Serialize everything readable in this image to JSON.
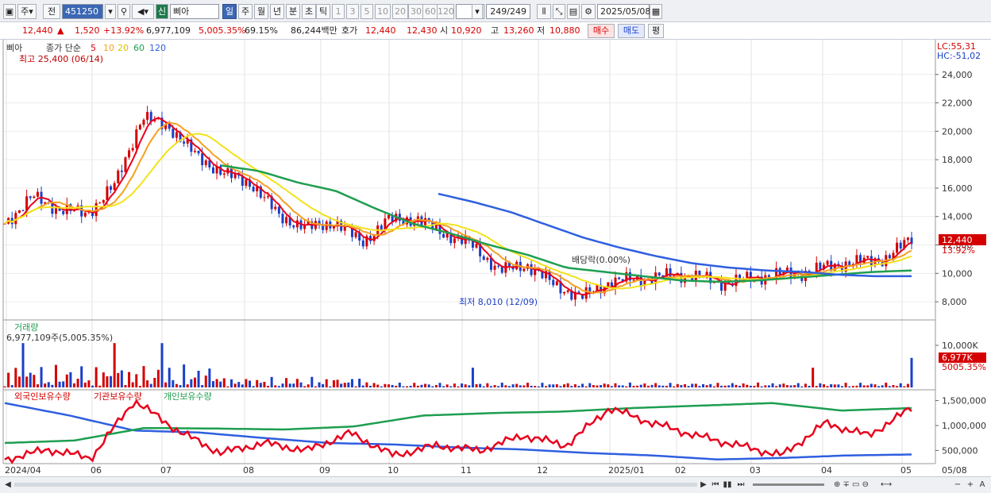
{
  "toolbar": {
    "market": "주",
    "prefix": "전",
    "code": "451250",
    "badge": "신",
    "name": "삐아",
    "periods": [
      "일",
      "주",
      "월",
      "년",
      "분",
      "초",
      "틱"
    ],
    "active_period": "일",
    "intervals": [
      "1",
      "3",
      "5",
      "10",
      "20",
      "30",
      "60",
      "120"
    ],
    "count": "249/249",
    "date": "2025/05/08"
  },
  "quote": {
    "price": "12,440",
    "arrow": "▲",
    "change": "1,520",
    "rate": "+13.92%",
    "volume": "6,977,109",
    "vol_rate": "5,005.35%",
    "turnover": "69.15%",
    "amount": "86,244백만",
    "hoga_label": "호가",
    "ask": "12,440",
    "bid": "12,430",
    "open_label": "시",
    "open": "10,920",
    "high_label": "고",
    "high": "13,260",
    "low_label": "저",
    "low": "10,880",
    "buy_btn": "매수",
    "sell_btn": "매도",
    "eval_btn": "평"
  },
  "legend": {
    "stock": "삐아",
    "ma_label": "종가 단순",
    "ma": [
      {
        "period": "5",
        "color": "#e8001c"
      },
      {
        "period": "10",
        "color": "#f5a020"
      },
      {
        "period": "20",
        "color": "#f2e21a"
      },
      {
        "period": "60",
        "color": "#1e9e50"
      },
      {
        "period": "120",
        "color": "#2f5fe0"
      }
    ],
    "lc": "LC:55,31",
    "hc": "HC:-51,02"
  },
  "annotations": {
    "high": "최고 25,400 (06/14)",
    "low": "최저 8,010 (12/09)",
    "dividend": "배당락(0.00%)"
  },
  "price_axis": {
    "ticks": [
      "24,000",
      "22,000",
      "20,000",
      "18,000",
      "16,000",
      "14,000",
      "12,000",
      "10,000",
      "8,000"
    ],
    "last": "12,440",
    "last_rate": "13.92%"
  },
  "volume_panel": {
    "title": "거래량",
    "info": "6,977,109주(5,005.35%)",
    "tick": "10,000K",
    "last": "6,977K",
    "last_rate": "5005.35%"
  },
  "holdings_panel": {
    "series": [
      {
        "name": "외국인보유수량",
        "color": "#d40000"
      },
      {
        "name": "기관보유수량",
        "color": "#d40000"
      },
      {
        "name": "개인보유수량",
        "color": "#1e9e50"
      }
    ],
    "ticks": [
      "1,500,000",
      "1,000,000",
      "500,000"
    ]
  },
  "date_axis": {
    "labels": [
      "2024/04",
      "06",
      "07",
      "08",
      "09",
      "10",
      "11",
      "12",
      "2025/01",
      "02",
      "03",
      "04",
      "05"
    ],
    "end": "05/08"
  },
  "chart_data": {
    "type": "line",
    "note_series": [
      "종가 5",
      "10",
      "20",
      "60",
      "120"
    ],
    "price_ylim": [
      7000,
      26000
    ],
    "volume_tick": 10000000,
    "holdings_ylim": [
      300000,
      1700000
    ],
    "months": [
      "2024/04",
      "06",
      "07",
      "08",
      "09",
      "10",
      "11",
      "12",
      "2025/01",
      "02",
      "03",
      "04",
      "05"
    ],
    "close_samples": [
      13500,
      15400,
      14500,
      14200,
      16200,
      21000,
      20300,
      18200,
      17000,
      16300,
      14000,
      13200,
      13600,
      12200,
      13800,
      13800,
      12800,
      12000,
      10200,
      10600,
      9200,
      8300,
      9400,
      9600,
      9800,
      9900,
      9300,
      9600,
      9900,
      10000,
      10500,
      10800,
      11000,
      12440
    ],
    "ma60_samples": [
      17600,
      17200,
      16400,
      15800,
      14600,
      13500,
      12800,
      12000,
      11300,
      10400,
      10100,
      9800,
      9500,
      9400,
      9500,
      9700,
      9900,
      10100,
      10200
    ],
    "ma120_samples": [
      15600,
      15000,
      14300,
      13400,
      12500,
      11800,
      11200,
      10700,
      10400,
      10200,
      10100,
      9900,
      9800,
      9800
    ],
    "foreign_samples": [
      320000,
      520000,
      350000,
      1500000,
      900000,
      450000,
      650000,
      500000,
      850000,
      400000,
      600000,
      500000,
      800000,
      600000,
      1350000,
      1050000,
      800000,
      600000,
      400000,
      1050000,
      800000,
      1350000
    ],
    "institution_samples": [
      650000,
      700000,
      950000,
      940000,
      920000,
      980000,
      1200000,
      1250000,
      1280000,
      1350000,
      1400000,
      1450000,
      1300000,
      1350000
    ],
    "individual_samples": [
      1450000,
      1200000,
      900000,
      860000,
      750000,
      650000,
      620000,
      560000,
      520000,
      450000,
      400000,
      320000,
      350000,
      400000,
      420000
    ]
  }
}
